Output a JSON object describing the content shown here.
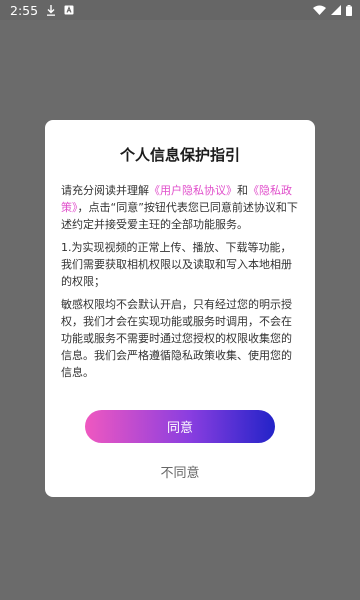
{
  "status_bar": {
    "time": "2:55",
    "icons": [
      "download-icon",
      "app-a-icon",
      "wifi-icon",
      "signal-icon",
      "battery-icon"
    ],
    "color": "#ffffff"
  },
  "dialog": {
    "title": "个人信息保护指引",
    "intro": {
      "prefix": "请充分阅读并理解",
      "user_agreement": "《用户隐私协议》",
      "and": "和",
      "privacy_policy": "《隐私政策》",
      "suffix": "，点击“同意”按钮代表您已同意前述协议和下述约定并接受爱主玨的全部功能服务。"
    },
    "item1": "1.为实现视频的正常上传、播放、下载等功能，我们需要获取相机权限以及读取和写入本地相册的权限；",
    "notice": "敏感权限均不会默认开启，只有经过您的明示授权，我们才会在实现功能或服务时调用，不会在功能或服务不需要时通过您授权的权限收集您的信息。我们会严格遵循隐私政策收集、使用您的信息。",
    "agree_label": "同意",
    "disagree_label": "不同意"
  },
  "colors": {
    "link": "#e04ecb",
    "button_gradient_start": "#ef58c0",
    "button_gradient_end": "#2323c8",
    "overlay": "#6b6b6b"
  }
}
